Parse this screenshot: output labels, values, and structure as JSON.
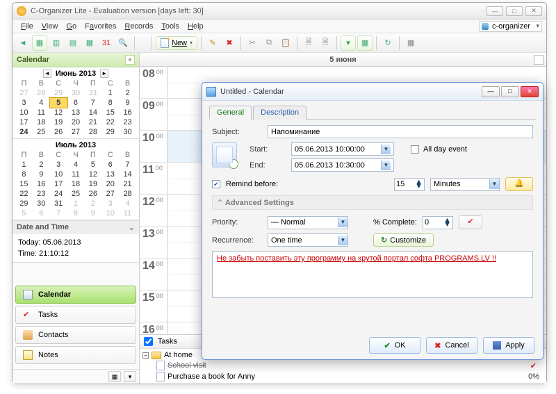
{
  "window": {
    "title": "C-Organizer Lite - Evaluation version [days left: 30]"
  },
  "menu": {
    "file": "File",
    "view": "View",
    "go": "Go",
    "favorites": "Favorites",
    "records": "Records",
    "tools": "Tools",
    "help": "Help",
    "profile": "c-organizer"
  },
  "toolbar": {
    "new_label": "New"
  },
  "sidebar": {
    "header": "Calendar",
    "cal1": {
      "title": "Июнь 2013",
      "dow": [
        "П",
        "В",
        "С",
        "Ч",
        "П",
        "С",
        "В"
      ],
      "grid": [
        {
          "v": "27",
          "m": 1
        },
        {
          "v": "28",
          "m": 1
        },
        {
          "v": "29",
          "m": 1
        },
        {
          "v": "30",
          "m": 1
        },
        {
          "v": "31",
          "m": 1
        },
        {
          "v": "1"
        },
        {
          "v": "2"
        },
        {
          "v": "3"
        },
        {
          "v": "4"
        },
        {
          "v": "5",
          "t": 1
        },
        {
          "v": "6"
        },
        {
          "v": "7"
        },
        {
          "v": "8"
        },
        {
          "v": "9"
        },
        {
          "v": "10"
        },
        {
          "v": "11"
        },
        {
          "v": "12"
        },
        {
          "v": "13"
        },
        {
          "v": "14"
        },
        {
          "v": "15"
        },
        {
          "v": "16"
        },
        {
          "v": "17"
        },
        {
          "v": "18"
        },
        {
          "v": "19"
        },
        {
          "v": "20"
        },
        {
          "v": "21"
        },
        {
          "v": "22"
        },
        {
          "v": "23"
        },
        {
          "v": "24",
          "b": 1
        },
        {
          "v": "25"
        },
        {
          "v": "26"
        },
        {
          "v": "27"
        },
        {
          "v": "28"
        },
        {
          "v": "29"
        },
        {
          "v": "30"
        }
      ]
    },
    "cal2": {
      "title": "Июль 2013",
      "dow": [
        "П",
        "В",
        "С",
        "Ч",
        "П",
        "С",
        "В"
      ],
      "grid": [
        {
          "v": "1"
        },
        {
          "v": "2"
        },
        {
          "v": "3"
        },
        {
          "v": "4"
        },
        {
          "v": "5"
        },
        {
          "v": "6"
        },
        {
          "v": "7"
        },
        {
          "v": "8"
        },
        {
          "v": "9"
        },
        {
          "v": "10"
        },
        {
          "v": "11"
        },
        {
          "v": "12"
        },
        {
          "v": "13"
        },
        {
          "v": "14"
        },
        {
          "v": "15"
        },
        {
          "v": "16"
        },
        {
          "v": "17"
        },
        {
          "v": "18"
        },
        {
          "v": "19"
        },
        {
          "v": "20"
        },
        {
          "v": "21"
        },
        {
          "v": "22"
        },
        {
          "v": "23"
        },
        {
          "v": "24"
        },
        {
          "v": "25"
        },
        {
          "v": "26"
        },
        {
          "v": "27"
        },
        {
          "v": "28"
        },
        {
          "v": "29"
        },
        {
          "v": "30"
        },
        {
          "v": "31"
        },
        {
          "v": "1",
          "m": 1
        },
        {
          "v": "2",
          "m": 1
        },
        {
          "v": "3",
          "m": 1
        },
        {
          "v": "4",
          "m": 1
        },
        {
          "v": "5",
          "m": 1
        },
        {
          "v": "6",
          "m": 1
        },
        {
          "v": "7",
          "m": 1
        },
        {
          "v": "8",
          "m": 1
        },
        {
          "v": "9",
          "m": 1
        },
        {
          "v": "10",
          "m": 1
        },
        {
          "v": "11",
          "m": 1
        }
      ]
    },
    "datetime_header": "Date and Time",
    "today_line": "Today: 05.06.2013",
    "time_line": "Time: 21:10:12",
    "nav": {
      "calendar": "Calendar",
      "tasks": "Tasks",
      "contacts": "Contacts",
      "notes": "Notes"
    }
  },
  "day": {
    "header": "5 июня",
    "hours": [
      "08",
      "09",
      "10",
      "11",
      "12",
      "13",
      "14",
      "15",
      "16"
    ],
    "minute_label": "00"
  },
  "tasks": {
    "header": "Tasks",
    "folder": "At home",
    "row1": "School visit",
    "row2": "Purchase a book for Anny",
    "pct2": "0%"
  },
  "dialog": {
    "title": "Untitled - Calendar",
    "tabs": {
      "general": "General",
      "description": "Description"
    },
    "labels": {
      "subject": "Subject:",
      "start": "Start:",
      "end": "End:",
      "allday": "All day event",
      "remind": "Remind before:",
      "advanced": "Advanced Settings",
      "priority": "Priority:",
      "complete": "% Complete:",
      "recurrence": "Recurrence:",
      "customize": "Customize"
    },
    "values": {
      "subject": "Напоминание",
      "start": "05.06.2013 10:00:00",
      "end": "05.06.2013 10:30:00",
      "remind_value": "15",
      "remind_unit": "Minutes",
      "priority": "―   Normal",
      "complete": "0",
      "recurrence": "One time",
      "note": "Не забыть поставить эту программу на крутой портал софта PROGRAMS.LV !!"
    },
    "buttons": {
      "ok": "OK",
      "cancel": "Cancel",
      "apply": "Apply"
    }
  }
}
